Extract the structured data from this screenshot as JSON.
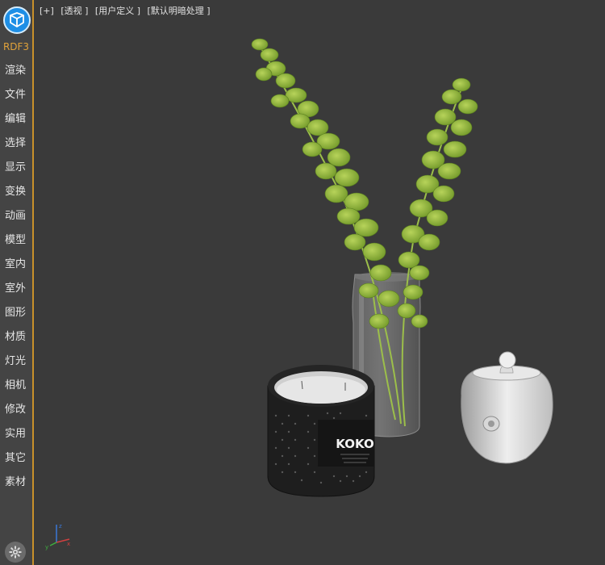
{
  "sidebar": {
    "brand": "RDF3",
    "items": [
      "渲染",
      "文件",
      "编辑",
      "选择",
      "显示",
      "变换",
      "动画",
      "模型",
      "室内",
      "室外",
      "图形",
      "材质",
      "灯光",
      "相机",
      "修改",
      "实用",
      "其它",
      "素材"
    ]
  },
  "viewport": {
    "labels": [
      "[+]",
      "[透视 ]",
      "[用户定义 ]",
      "[默认明暗处理 ]"
    ]
  },
  "scene": {
    "candle_label": "KOKO"
  },
  "colors": {
    "accent": "#c8902a",
    "logo": "#1e8fe6",
    "sidebar_bg": "#444444",
    "viewport_bg": "#3a3a3a"
  }
}
